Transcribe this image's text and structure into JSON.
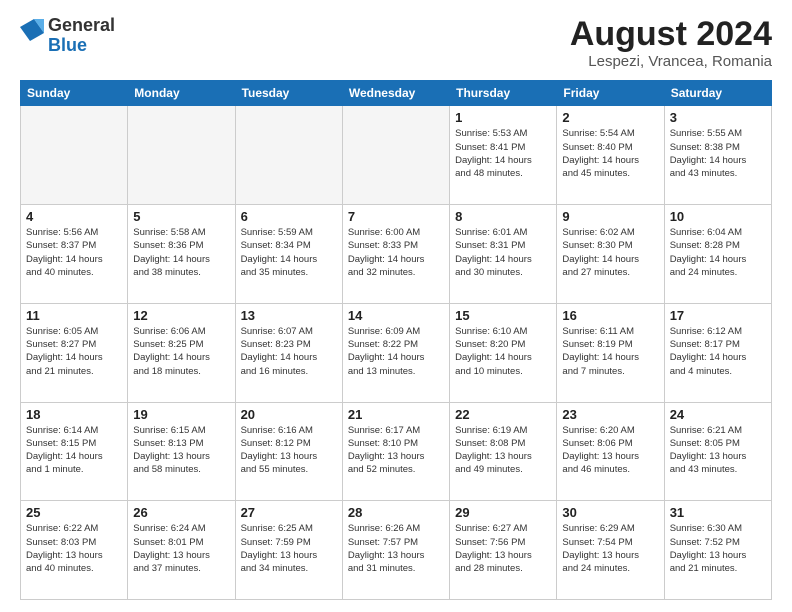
{
  "logo": {
    "general": "General",
    "blue": "Blue"
  },
  "title": "August 2024",
  "subtitle": "Lespezi, Vrancea, Romania",
  "weekdays": [
    "Sunday",
    "Monday",
    "Tuesday",
    "Wednesday",
    "Thursday",
    "Friday",
    "Saturday"
  ],
  "weeks": [
    [
      {
        "day": "",
        "info": ""
      },
      {
        "day": "",
        "info": ""
      },
      {
        "day": "",
        "info": ""
      },
      {
        "day": "",
        "info": ""
      },
      {
        "day": "1",
        "info": "Sunrise: 5:53 AM\nSunset: 8:41 PM\nDaylight: 14 hours\nand 48 minutes."
      },
      {
        "day": "2",
        "info": "Sunrise: 5:54 AM\nSunset: 8:40 PM\nDaylight: 14 hours\nand 45 minutes."
      },
      {
        "day": "3",
        "info": "Sunrise: 5:55 AM\nSunset: 8:38 PM\nDaylight: 14 hours\nand 43 minutes."
      }
    ],
    [
      {
        "day": "4",
        "info": "Sunrise: 5:56 AM\nSunset: 8:37 PM\nDaylight: 14 hours\nand 40 minutes."
      },
      {
        "day": "5",
        "info": "Sunrise: 5:58 AM\nSunset: 8:36 PM\nDaylight: 14 hours\nand 38 minutes."
      },
      {
        "day": "6",
        "info": "Sunrise: 5:59 AM\nSunset: 8:34 PM\nDaylight: 14 hours\nand 35 minutes."
      },
      {
        "day": "7",
        "info": "Sunrise: 6:00 AM\nSunset: 8:33 PM\nDaylight: 14 hours\nand 32 minutes."
      },
      {
        "day": "8",
        "info": "Sunrise: 6:01 AM\nSunset: 8:31 PM\nDaylight: 14 hours\nand 30 minutes."
      },
      {
        "day": "9",
        "info": "Sunrise: 6:02 AM\nSunset: 8:30 PM\nDaylight: 14 hours\nand 27 minutes."
      },
      {
        "day": "10",
        "info": "Sunrise: 6:04 AM\nSunset: 8:28 PM\nDaylight: 14 hours\nand 24 minutes."
      }
    ],
    [
      {
        "day": "11",
        "info": "Sunrise: 6:05 AM\nSunset: 8:27 PM\nDaylight: 14 hours\nand 21 minutes."
      },
      {
        "day": "12",
        "info": "Sunrise: 6:06 AM\nSunset: 8:25 PM\nDaylight: 14 hours\nand 18 minutes."
      },
      {
        "day": "13",
        "info": "Sunrise: 6:07 AM\nSunset: 8:23 PM\nDaylight: 14 hours\nand 16 minutes."
      },
      {
        "day": "14",
        "info": "Sunrise: 6:09 AM\nSunset: 8:22 PM\nDaylight: 14 hours\nand 13 minutes."
      },
      {
        "day": "15",
        "info": "Sunrise: 6:10 AM\nSunset: 8:20 PM\nDaylight: 14 hours\nand 10 minutes."
      },
      {
        "day": "16",
        "info": "Sunrise: 6:11 AM\nSunset: 8:19 PM\nDaylight: 14 hours\nand 7 minutes."
      },
      {
        "day": "17",
        "info": "Sunrise: 6:12 AM\nSunset: 8:17 PM\nDaylight: 14 hours\nand 4 minutes."
      }
    ],
    [
      {
        "day": "18",
        "info": "Sunrise: 6:14 AM\nSunset: 8:15 PM\nDaylight: 14 hours\nand 1 minute."
      },
      {
        "day": "19",
        "info": "Sunrise: 6:15 AM\nSunset: 8:13 PM\nDaylight: 13 hours\nand 58 minutes."
      },
      {
        "day": "20",
        "info": "Sunrise: 6:16 AM\nSunset: 8:12 PM\nDaylight: 13 hours\nand 55 minutes."
      },
      {
        "day": "21",
        "info": "Sunrise: 6:17 AM\nSunset: 8:10 PM\nDaylight: 13 hours\nand 52 minutes."
      },
      {
        "day": "22",
        "info": "Sunrise: 6:19 AM\nSunset: 8:08 PM\nDaylight: 13 hours\nand 49 minutes."
      },
      {
        "day": "23",
        "info": "Sunrise: 6:20 AM\nSunset: 8:06 PM\nDaylight: 13 hours\nand 46 minutes."
      },
      {
        "day": "24",
        "info": "Sunrise: 6:21 AM\nSunset: 8:05 PM\nDaylight: 13 hours\nand 43 minutes."
      }
    ],
    [
      {
        "day": "25",
        "info": "Sunrise: 6:22 AM\nSunset: 8:03 PM\nDaylight: 13 hours\nand 40 minutes."
      },
      {
        "day": "26",
        "info": "Sunrise: 6:24 AM\nSunset: 8:01 PM\nDaylight: 13 hours\nand 37 minutes."
      },
      {
        "day": "27",
        "info": "Sunrise: 6:25 AM\nSunset: 7:59 PM\nDaylight: 13 hours\nand 34 minutes."
      },
      {
        "day": "28",
        "info": "Sunrise: 6:26 AM\nSunset: 7:57 PM\nDaylight: 13 hours\nand 31 minutes."
      },
      {
        "day": "29",
        "info": "Sunrise: 6:27 AM\nSunset: 7:56 PM\nDaylight: 13 hours\nand 28 minutes."
      },
      {
        "day": "30",
        "info": "Sunrise: 6:29 AM\nSunset: 7:54 PM\nDaylight: 13 hours\nand 24 minutes."
      },
      {
        "day": "31",
        "info": "Sunrise: 6:30 AM\nSunset: 7:52 PM\nDaylight: 13 hours\nand 21 minutes."
      }
    ]
  ]
}
